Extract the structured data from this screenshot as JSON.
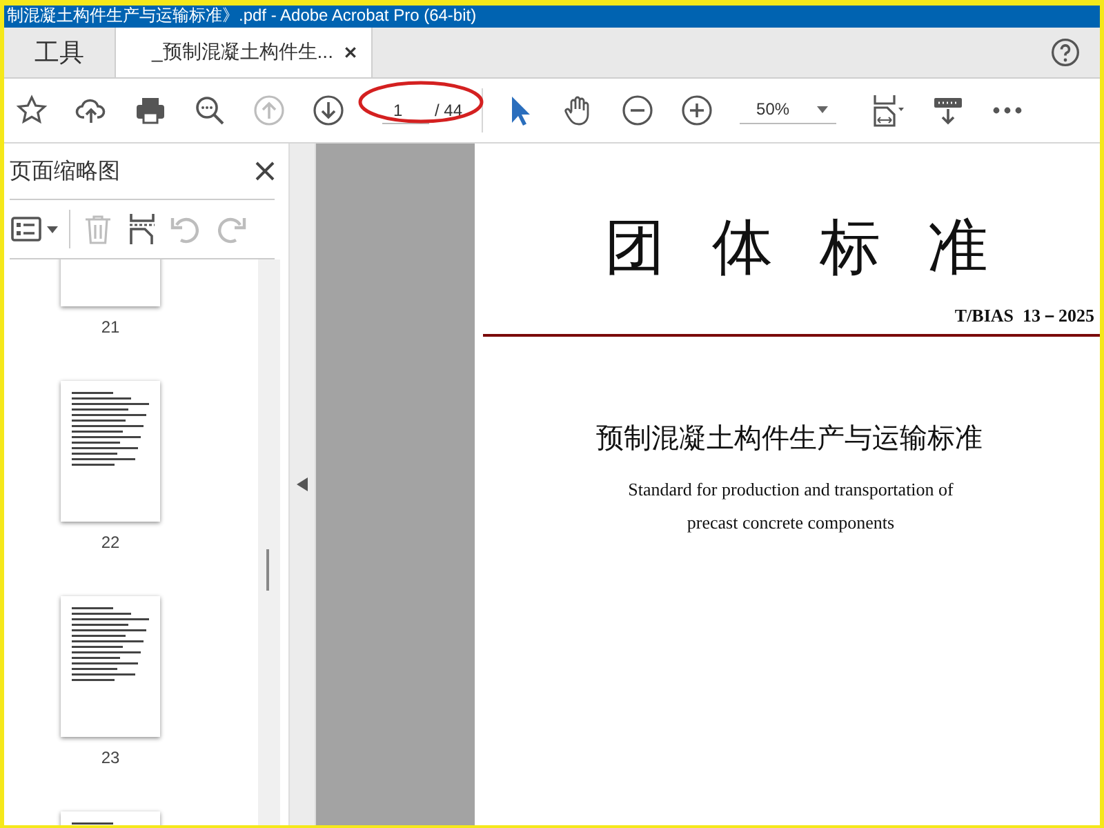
{
  "title_bar": {
    "title": "制混凝土构件生产与运输标准》.pdf - Adobe Acrobat Pro (64-bit)"
  },
  "tabs": [
    {
      "label": "工具",
      "selected": false
    },
    {
      "label": "_预制混凝土构件生...",
      "selected": true,
      "closable": true
    }
  ],
  "toolbar": {
    "buttons": [
      {
        "kind": "star",
        "disabled": false
      },
      {
        "kind": "upload",
        "disabled": false
      },
      {
        "kind": "print",
        "disabled": false
      },
      {
        "kind": "find",
        "disabled": false
      },
      {
        "kind": "prev",
        "disabled": true
      },
      {
        "kind": "next",
        "disabled": false
      },
      {
        "kind": "page"
      },
      {
        "kind": "divider"
      },
      {
        "kind": "select",
        "selected": true
      },
      {
        "kind": "hand",
        "selected": false
      },
      {
        "kind": "zoomout",
        "disabled": false
      },
      {
        "kind": "zoomin",
        "disabled": false
      },
      {
        "kind": "zoom"
      },
      {
        "kind": "fit",
        "disabled": false
      },
      {
        "kind": "read",
        "disabled": false
      },
      {
        "kind": "more",
        "disabled": false
      }
    ],
    "page_field": {
      "value": "1",
      "total": "/ 44"
    },
    "zoom_field": {
      "value": "50%"
    },
    "markup": {
      "kind": "ellipse"
    }
  },
  "panel": {
    "title": "页面缩略图",
    "tools": [
      {
        "kind": "options",
        "disabled": false
      },
      {
        "kind": "delete",
        "disabled": true
      },
      {
        "kind": "extract",
        "disabled": false
      },
      {
        "kind": "undo",
        "disabled": true
      },
      {
        "kind": "redo",
        "disabled": true
      }
    ],
    "thumbnails": [
      {
        "label": "21",
        "selected": false
      },
      {
        "label": "22",
        "selected": false
      },
      {
        "label": "23",
        "selected": false
      },
      {
        "selected": false
      }
    ]
  },
  "document": {
    "heading": "团体标准",
    "code": "T/BIAS  13－2025",
    "title": "预制混凝土构件生产与运输标准",
    "subtitle_lines": [
      "Standard for production and transportation of",
      "precast concrete components"
    ]
  }
}
